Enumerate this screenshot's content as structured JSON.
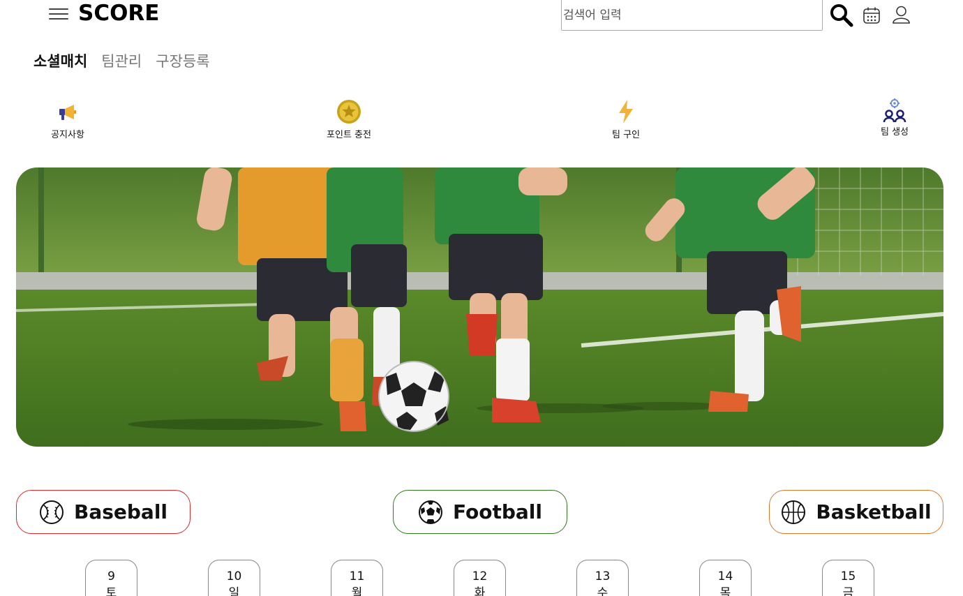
{
  "header": {
    "logo": "SCORE",
    "search_placeholder": "검색어 입력",
    "icons": [
      "hamburger-icon",
      "search-icon",
      "calendar-icon",
      "user-icon"
    ]
  },
  "nav": {
    "items": [
      {
        "label": "소셜매치",
        "active": true
      },
      {
        "label": "팀관리",
        "active": false
      },
      {
        "label": "구장등록",
        "active": false
      }
    ]
  },
  "quick_menu": [
    {
      "label": "공지사항",
      "icon": "megaphone-icon"
    },
    {
      "label": "포인트 충전",
      "icon": "coin-icon"
    },
    {
      "label": "팀 구인",
      "icon": "lightning-icon"
    },
    {
      "label": "팀 생성",
      "icon": "team-create-icon"
    }
  ],
  "sports": [
    {
      "label": "Baseball",
      "icon": "baseball-icon",
      "color": "#d62b2b"
    },
    {
      "label": "Football",
      "icon": "soccer-ball-icon",
      "color": "#2f7a1f"
    },
    {
      "label": "Basketball",
      "icon": "basketball-icon",
      "color": "#d97a2b"
    }
  ],
  "dates": [
    {
      "day": "9",
      "weekday": "토"
    },
    {
      "day": "10",
      "weekday": "일"
    },
    {
      "day": "11",
      "weekday": "월"
    },
    {
      "day": "12",
      "weekday": "화"
    },
    {
      "day": "13",
      "weekday": "수"
    },
    {
      "day": "14",
      "weekday": "목"
    },
    {
      "day": "15",
      "weekday": "금"
    }
  ]
}
